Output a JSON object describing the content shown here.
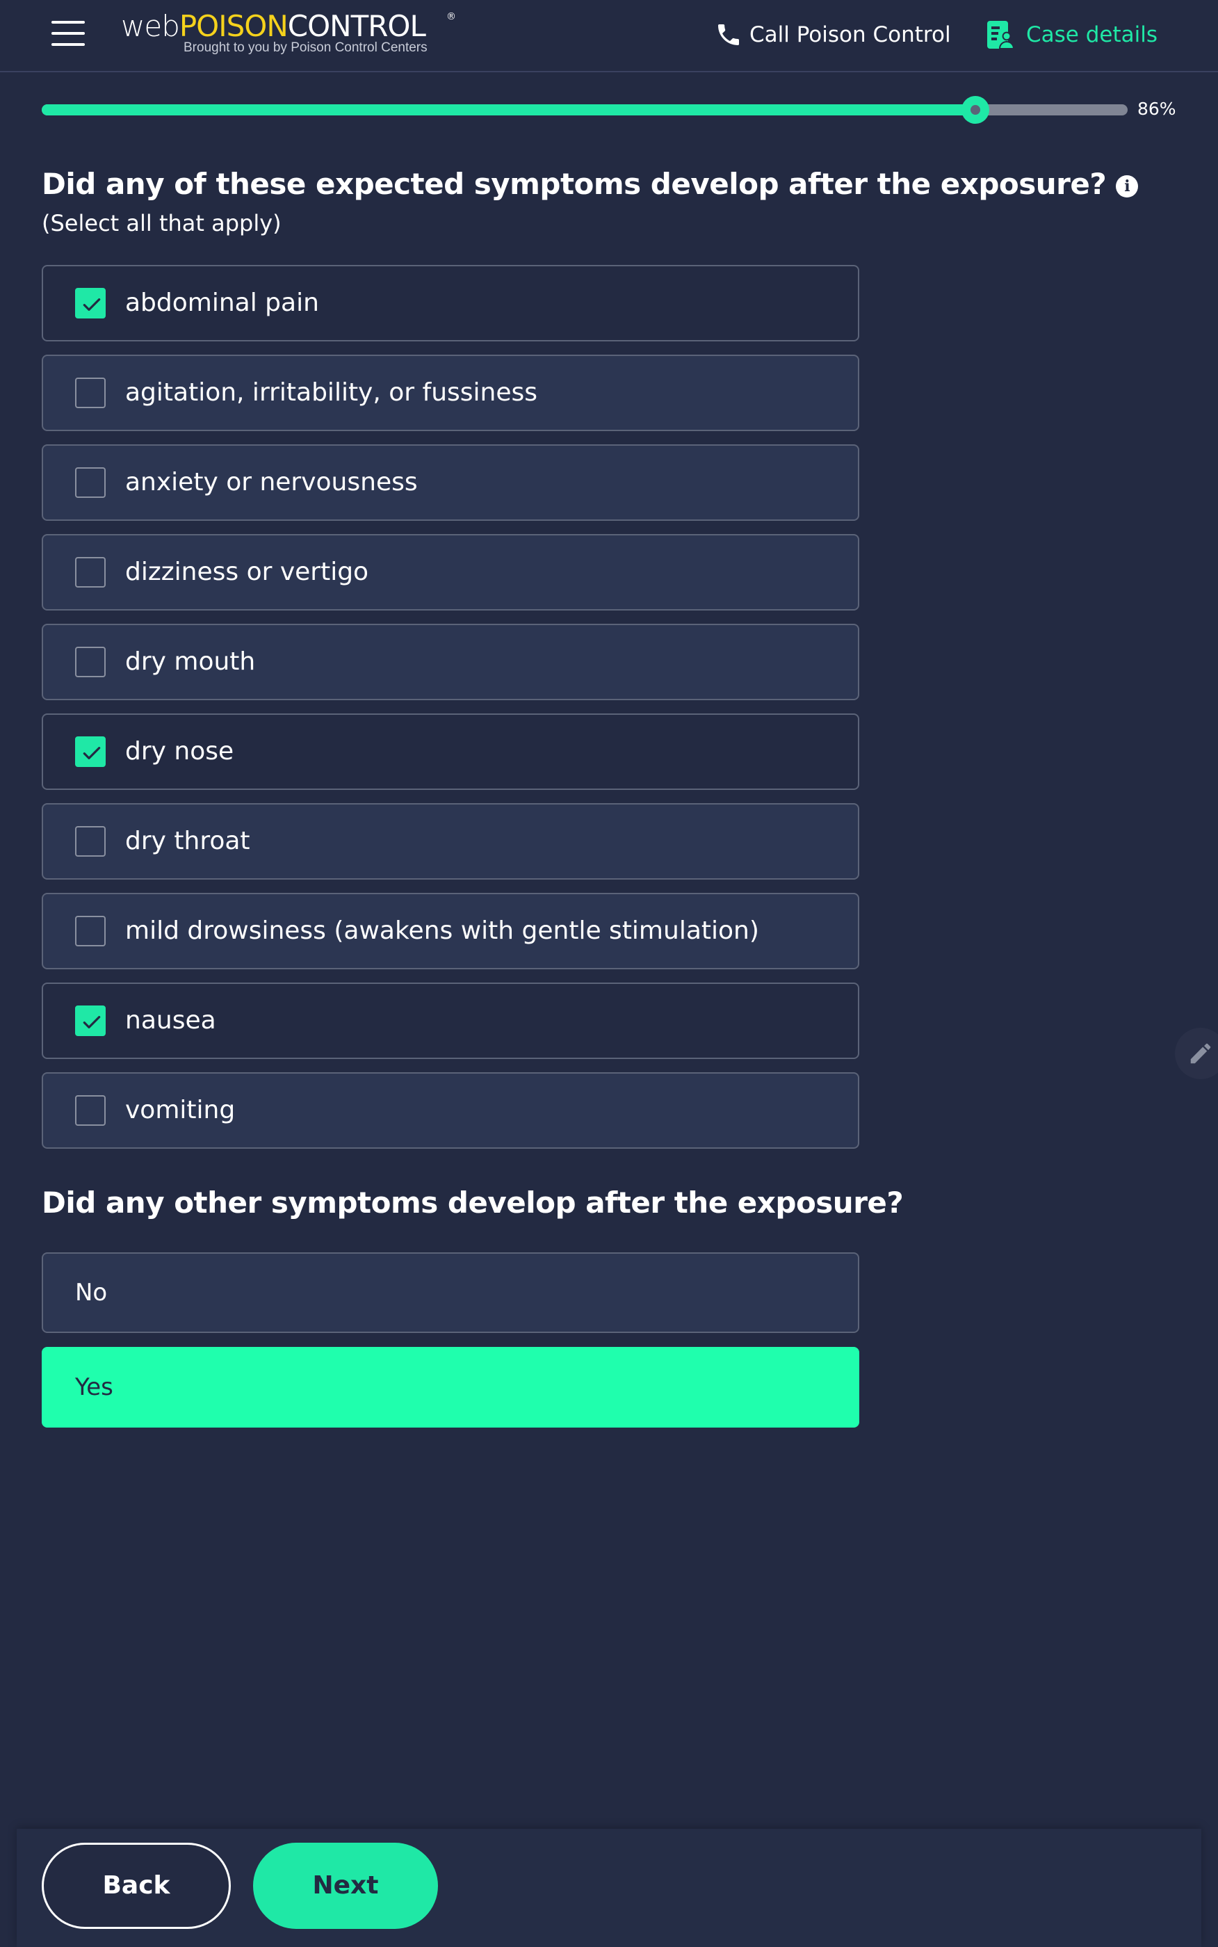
{
  "header": {
    "logo": {
      "web": "web",
      "poison": "POISON",
      "control": "CONTROL",
      "registered": "®",
      "tagline": "Brought to you by Poison Control Centers"
    },
    "call_label": "Call Poison Control",
    "case_label": "Case details",
    "icons": {
      "menu": "hamburger-menu-icon",
      "call": "phone-icon",
      "case": "case-details-icon"
    }
  },
  "progress": {
    "value": 0.86,
    "label": "86%"
  },
  "question1": {
    "text": "Did any of these expected symptoms develop after the exposure?",
    "sub": "(Select all that apply)",
    "info_icon": "info-icon"
  },
  "options": [
    {
      "label": "abdominal pain",
      "checked": true
    },
    {
      "label": "agitation, irritability, or fussiness",
      "checked": false
    },
    {
      "label": "anxiety or nervousness",
      "checked": false
    },
    {
      "label": "dizziness or vertigo",
      "checked": false
    },
    {
      "label": "dry mouth",
      "checked": false
    },
    {
      "label": "dry nose",
      "checked": true
    },
    {
      "label": "dry throat",
      "checked": false
    },
    {
      "label": "mild drowsiness (awakens with gentle stimulation)",
      "checked": false
    },
    {
      "label": "nausea",
      "checked": true
    },
    {
      "label": "vomiting",
      "checked": false
    }
  ],
  "question2": {
    "text": "Did any other symptoms develop after the exposure?",
    "no_label": "No",
    "yes_label": "Yes",
    "selected": "Yes"
  },
  "footer": {
    "back_label": "Back",
    "next_label": "Next"
  },
  "colors": {
    "accent": "#1fe8a6",
    "background": "#232a42",
    "option_bg": "#2c3652",
    "logo_yellow": "#f5d21c"
  }
}
